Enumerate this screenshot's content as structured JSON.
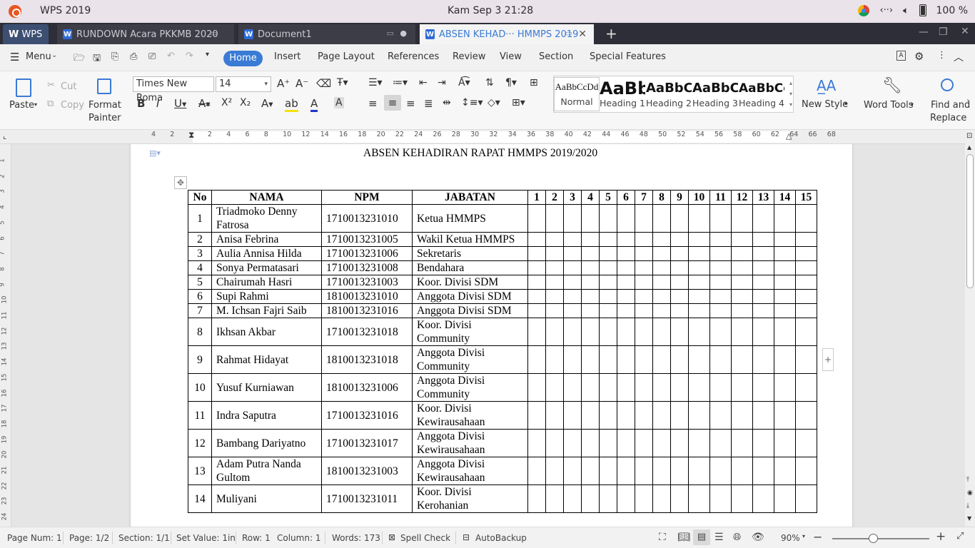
{
  "system_bar": {
    "app_name": "WPS 2019",
    "clock": "Kam Sep 3  21:28",
    "battery": "100 %"
  },
  "tabs": [
    {
      "label": "WPS"
    },
    {
      "label": "RUNDOWN Acara PKKMB 2020"
    },
    {
      "label": "Document1"
    },
    {
      "label": "ABSEN KEHAD··· HMMPS 2019"
    }
  ],
  "menu": {
    "menu_label": "Menu",
    "items": [
      "Home",
      "Insert",
      "Page Layout",
      "References",
      "Review",
      "View",
      "Section",
      "Special Features"
    ]
  },
  "ribbon": {
    "paste": "Paste",
    "cut": "Cut",
    "copy": "Copy",
    "format_painter_1": "Format",
    "format_painter_2": "Painter",
    "font_name": "Times New Roma",
    "font_size": "14",
    "styles": [
      {
        "sample": "AaBbCcDd",
        "label": "Normal"
      },
      {
        "sample": "AaBb",
        "label": "Heading 1"
      },
      {
        "sample": "AaBbC",
        "label": "Heading 2"
      },
      {
        "sample": "AaBbC",
        "label": "Heading 3"
      },
      {
        "sample": "AaBbCc",
        "label": "Heading 4"
      }
    ],
    "new_style": "New Style",
    "word_tools": "Word Tools",
    "find_replace_1": "Find and",
    "find_replace_2": "Replace"
  },
  "ruler": {
    "ticks": [
      "4",
      "2",
      "",
      "2",
      "4",
      "6",
      "8",
      "10",
      "12",
      "14",
      "16",
      "18",
      "20",
      "22",
      "24",
      "26",
      "28",
      "30",
      "32",
      "34",
      "36",
      "38",
      "40",
      "42",
      "44",
      "46",
      "48",
      "50",
      "52",
      "54",
      "56",
      "58",
      "60",
      "62",
      "64",
      "66",
      "68"
    ]
  },
  "vruler": {
    "ticks": [
      "1",
      "2",
      "3",
      "4",
      "5",
      "6",
      "7",
      "8",
      "9",
      "10",
      "11",
      "12",
      "13",
      "14",
      "15",
      "16",
      "17",
      "18",
      "19",
      "20",
      "21",
      "22",
      "23",
      "24"
    ]
  },
  "document": {
    "title": "ABSEN KEHADIRAN RAPAT HMMPS 2019/2020",
    "headers": [
      "No",
      "NAMA",
      "NPM",
      "JABATAN",
      "1",
      "2",
      "3",
      "4",
      "5",
      "6",
      "7",
      "8",
      "9",
      "10",
      "11",
      "12",
      "13",
      "14",
      "15"
    ],
    "rows": [
      {
        "no": "1",
        "nama": "Triadmoko Denny Fatrosa",
        "npm": "1710013231010",
        "jabatan": "Ketua HMMPS"
      },
      {
        "no": "2",
        "nama": "Anisa Febrina",
        "npm": "1710013231005",
        "jabatan": "Wakil Ketua HMMPS"
      },
      {
        "no": "3",
        "nama": "Aulia Annisa Hilda",
        "npm": "1710013231006",
        "jabatan": "Sekretaris"
      },
      {
        "no": "4",
        "nama": "Sonya Permatasari",
        "npm": "1710013231008",
        "jabatan": "Bendahara"
      },
      {
        "no": "5",
        "nama": "Chairumah Hasri",
        "npm": "1710013231003",
        "jabatan": "Koor. Divisi SDM"
      },
      {
        "no": "6",
        "nama": "Supi Rahmi",
        "npm": "1810013231010",
        "jabatan": "Anggota Divisi SDM"
      },
      {
        "no": "7",
        "nama": "M. Ichsan Fajri Saib",
        "npm": "1810013231016",
        "jabatan": "Anggota Divisi SDM"
      },
      {
        "no": "8",
        "nama": "Ikhsan Akbar",
        "npm": "1710013231018",
        "jabatan": "Koor. Divisi Community"
      },
      {
        "no": "9",
        "nama": "Rahmat Hidayat",
        "npm": "1810013231018",
        "jabatan": "Anggota Divisi Community"
      },
      {
        "no": "10",
        "nama": "Yusuf Kurniawan",
        "npm": "1810013231006",
        "jabatan": "Anggota Divisi Community"
      },
      {
        "no": "11",
        "nama": "Indra Saputra",
        "npm": "1710013231016",
        "jabatan": "Koor. Divisi Kewirausahaan"
      },
      {
        "no": "12",
        "nama": "Bambang Dariyatno",
        "npm": "1710013231017",
        "jabatan": "Anggota Divisi Kewirausahaan"
      },
      {
        "no": "13",
        "nama": "Adam Putra Nanda Gultom",
        "npm": "1810013231003",
        "jabatan": "Anggota Divisi Kewirausahaan"
      },
      {
        "no": "14",
        "nama": "Muliyani",
        "npm": "1710013231011",
        "jabatan": "Koor. Divisi Kerohanian"
      }
    ]
  },
  "status": {
    "page_num": "Page Num: 1",
    "page": "Page: 1/2",
    "section": "Section: 1/1",
    "set_value": "Set Value: 1in",
    "row": "Row: 1",
    "column": "Column: 1",
    "words": "Words: 173",
    "spell_check": "Spell Check",
    "autobackup": "AutoBackup",
    "zoom": "90%"
  },
  "colors": {
    "accent": "#3a7bd5",
    "tab_bar": "#2e2e38",
    "sys_bar": "#eae3e9"
  }
}
